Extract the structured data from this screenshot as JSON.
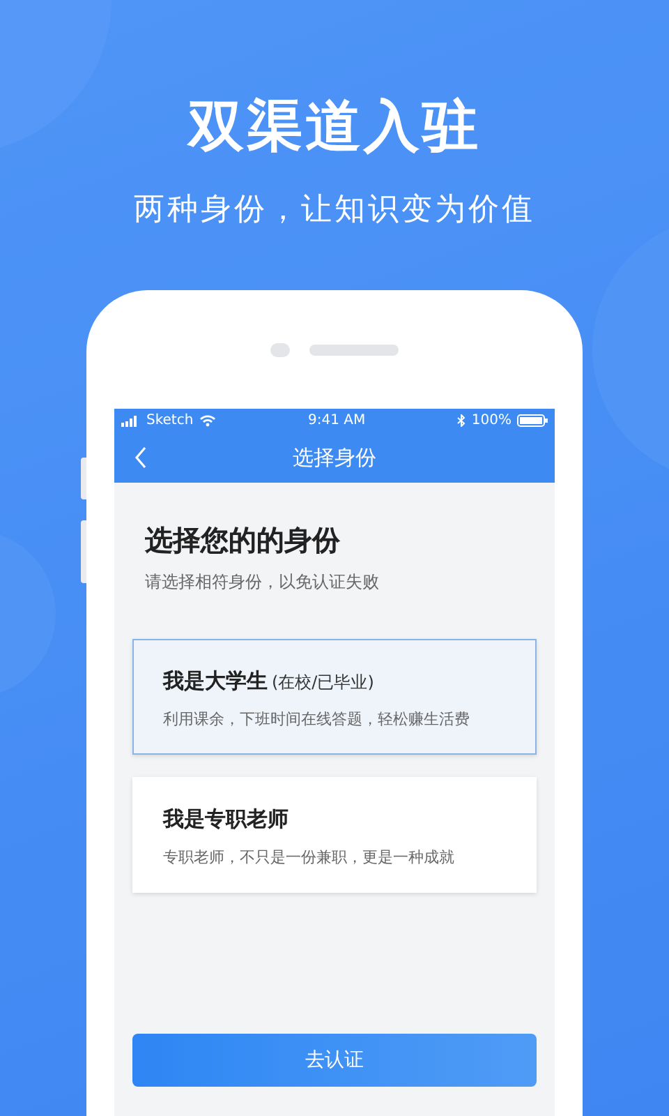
{
  "headline": "双渠道入驻",
  "tagline": "两种身份，让知识变为价值",
  "status_bar": {
    "carrier": "Sketch",
    "time": "9:41 AM",
    "battery": "100%"
  },
  "nav": {
    "title": "选择身份"
  },
  "heading": "选择您的的身份",
  "hint": "请选择相符身份，以免认证失败",
  "options": [
    {
      "title": "我是大学生",
      "note": "(在校/已毕业)",
      "description": "利用课余，下班时间在线答题，轻松赚生活费",
      "selected": true
    },
    {
      "title": "我是专职老师",
      "description": "专职老师，不只是一份兼职，更是一种成就",
      "selected": false
    }
  ],
  "button": "去认证"
}
